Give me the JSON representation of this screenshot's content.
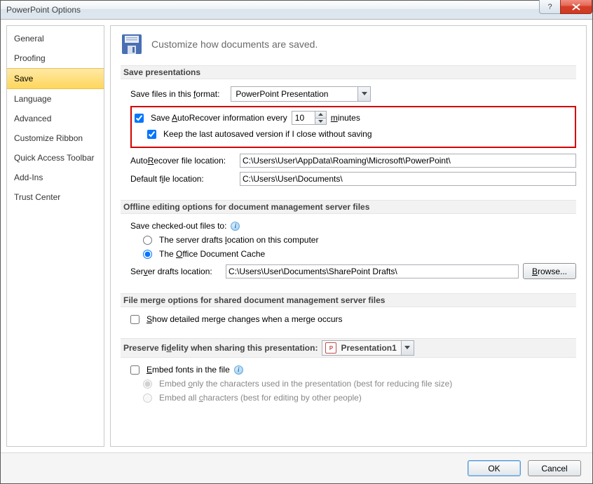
{
  "window": {
    "title": "PowerPoint Options"
  },
  "titlebar_buttons": {
    "help_glyph": "?",
    "close_label": "Close"
  },
  "sidebar": {
    "items": [
      {
        "label": "General"
      },
      {
        "label": "Proofing"
      },
      {
        "label": "Save",
        "selected": true
      },
      {
        "label": "Language"
      },
      {
        "label": "Advanced"
      },
      {
        "label": "Customize Ribbon"
      },
      {
        "label": "Quick Access Toolbar"
      },
      {
        "label": "Add-Ins"
      },
      {
        "label": "Trust Center"
      }
    ]
  },
  "heading": "Customize how documents are saved.",
  "sections": {
    "save_presentations": {
      "title": "Save presentations",
      "format_label_pre": "Save files in this ",
      "format_label_accel": "f",
      "format_label_post": "ormat:",
      "format_value": "PowerPoint Presentation",
      "autorecover_checked": true,
      "autorecover_pre": "Save ",
      "autorecover_accel": "A",
      "autorecover_mid": "utoRecover information every",
      "autorecover_value": "10",
      "autorecover_unit_accel": "m",
      "autorecover_unit": "inutes",
      "keeplast_checked": true,
      "keeplast_text": "Keep the last autosaved version if I close without saving",
      "ar_loc_label_pre": "Auto",
      "ar_loc_label_accel": "R",
      "ar_loc_label_post": "ecover file location:",
      "ar_loc_value": "C:\\Users\\User\\AppData\\Roaming\\Microsoft\\PowerPoint\\",
      "def_loc_label_pre": "Default f",
      "def_loc_label_accel": "i",
      "def_loc_label_post": "le location:",
      "def_loc_value": "C:\\Users\\User\\Documents\\"
    },
    "offline": {
      "title": "Offline editing options for document management server files",
      "save_checked_label": "Save checked-out files to:",
      "radio_server_pre": "The server drafts ",
      "radio_server_accel": "l",
      "radio_server_post": "ocation on this computer",
      "radio_cache_pre": "The ",
      "radio_cache_accel": "O",
      "radio_cache_post": "ffice Document Cache",
      "drafts_label_pre": "Ser",
      "drafts_label_accel": "v",
      "drafts_label_post": "er drafts location:",
      "drafts_value": "C:\\Users\\User\\Documents\\SharePoint Drafts\\",
      "browse_label": "Browse..."
    },
    "merge": {
      "title": "File merge options for shared document management server files",
      "detailed_pre": "",
      "detailed_accel": "S",
      "detailed_post": "how detailed merge changes when a merge occurs"
    },
    "preserve": {
      "title_pre": "Preserve fi",
      "title_accel": "d",
      "title_post": "elity when sharing this presentation:",
      "presentation_value": "Presentation1",
      "embed_pre": "",
      "embed_accel": "E",
      "embed_post": "mbed fonts in the file",
      "embed_only_pre": "Embed ",
      "embed_only_accel": "o",
      "embed_only_post": "nly the characters used in the presentation (best for reducing file size)",
      "embed_all_pre": "Embed all ",
      "embed_all_accel": "c",
      "embed_all_post": "haracters (best for editing by other people)"
    }
  },
  "footer": {
    "ok": "OK",
    "cancel": "Cancel"
  }
}
